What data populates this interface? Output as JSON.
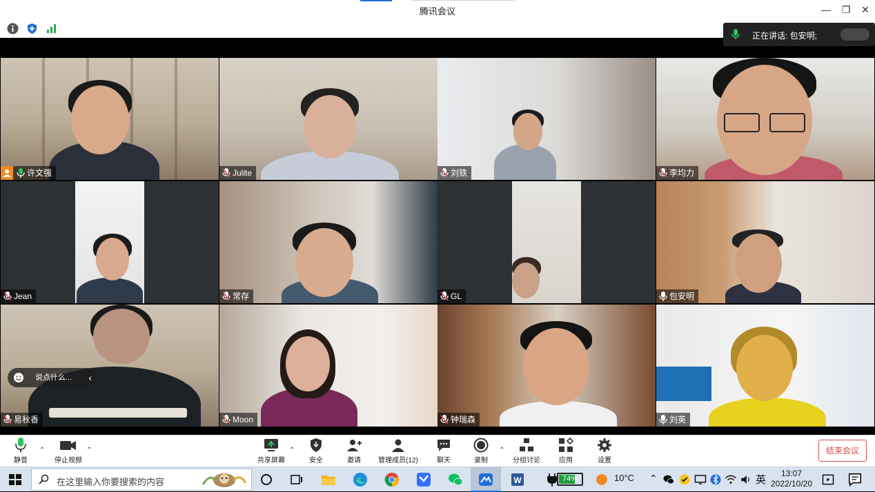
{
  "window": {
    "title": "腾讯会议",
    "minimize": "—",
    "maximize": "❐",
    "close": "✕"
  },
  "infobar": {
    "icons": [
      "info-icon",
      "shield-icon",
      "signal-icon"
    ]
  },
  "speaking": {
    "text": "正在讲话: 包安明;"
  },
  "participants": [
    {
      "name": "许文强",
      "host": true,
      "mic": "on"
    },
    {
      "name": "Julite",
      "host": false,
      "mic": "muted"
    },
    {
      "name": "刘铁",
      "host": false,
      "mic": "muted"
    },
    {
      "name": "李均力",
      "host": false,
      "mic": "muted"
    },
    {
      "name": "Jean",
      "host": false,
      "mic": "muted"
    },
    {
      "name": "常存",
      "host": false,
      "mic": "muted"
    },
    {
      "name": "GL",
      "host": false,
      "mic": "muted"
    },
    {
      "name": "包安明",
      "host": false,
      "mic": "on",
      "speaking": true
    },
    {
      "name": "易秋香",
      "host": false,
      "mic": "muted"
    },
    {
      "name": "Moon",
      "host": false,
      "mic": "muted"
    },
    {
      "name": "钟瑞森",
      "host": false,
      "mic": "muted"
    },
    {
      "name": "刘英",
      "host": false,
      "mic": "on"
    }
  ],
  "chat_bubble": {
    "placeholder": "说点什么..."
  },
  "toolbar": {
    "mute": "静音",
    "stop_video": "停止视频",
    "share_screen": "共享屏幕",
    "security": "安全",
    "invite": "邀请",
    "manage_members": "管理成员(12)",
    "chat": "聊天",
    "record": "录制",
    "breakout": "分组讨论",
    "apps": "应用",
    "settings": "设置",
    "end_meeting": "结束会议"
  },
  "taskbar": {
    "search_placeholder": "在这里输入你要搜索的内容",
    "battery": "74%",
    "battery_level": 0.74,
    "weather": "10°C",
    "ime": "英",
    "time": "13:07",
    "date": "2022/10/20",
    "apps": [
      "cortana-icon",
      "task-view-icon",
      "file-explorer-icon",
      "edge-icon",
      "chrome-icon",
      "feishu-icon",
      "wechat-icon",
      "tencent-meeting-icon",
      "word-icon"
    ]
  },
  "colors": {
    "accent_blue": "#1e6fd9",
    "speaking_green": "#26b35a",
    "end_red": "#e04a4a",
    "host_orange": "#f08a24"
  }
}
